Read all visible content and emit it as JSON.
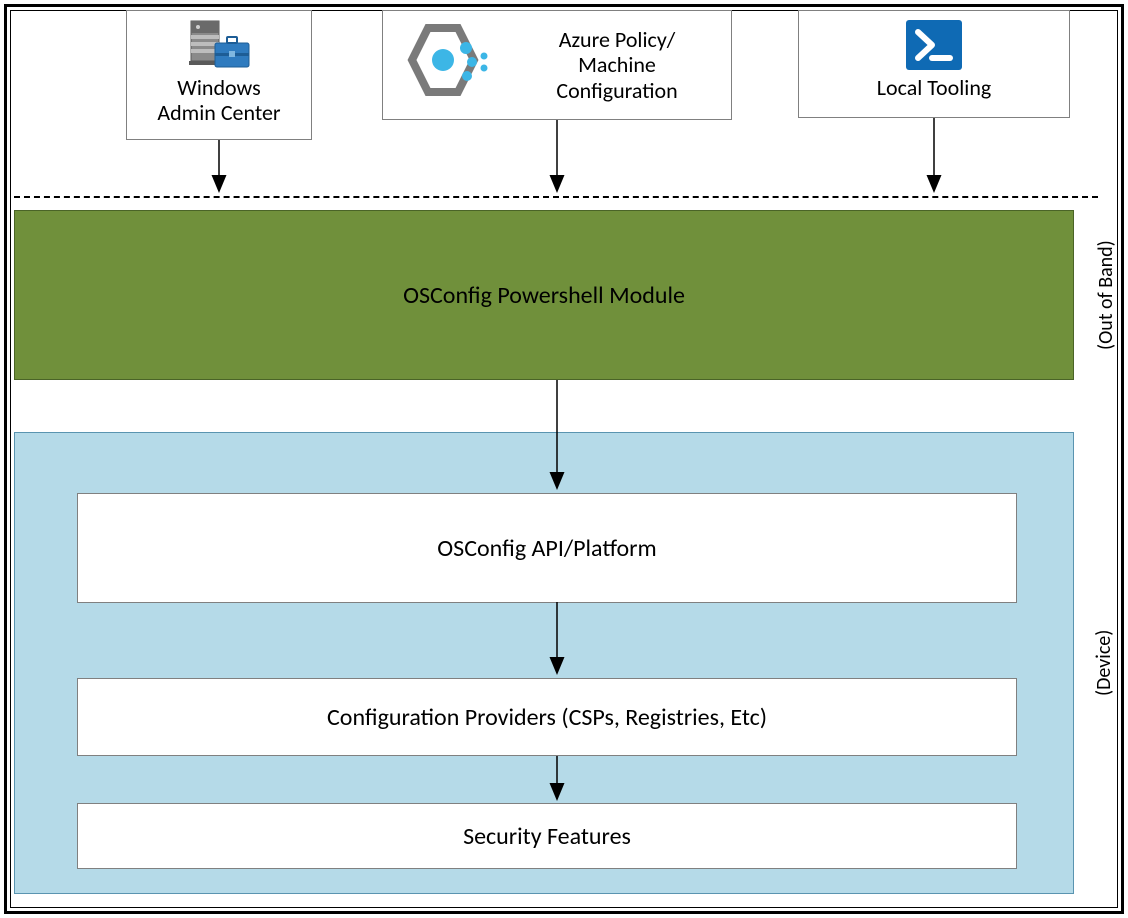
{
  "top_row": {
    "wac": {
      "label": "Windows\nAdmin Center",
      "icon": "server-briefcase-icon"
    },
    "azure_policy": {
      "label": "Azure Policy/\nMachine\nConfiguration",
      "icon": "azure-policy-icon"
    },
    "local_tooling": {
      "label": "Local Tooling",
      "icon": "powershell-icon"
    }
  },
  "layers": {
    "osconfig_module": "OSConfig Powershell Module",
    "api_platform": "OSConfig API/Platform",
    "config_providers": "Configuration Providers (CSPs, Registries, Etc)",
    "security_features": "Security Features"
  },
  "side_labels": {
    "out_of_band": "(Out of Band)",
    "device": "(Device)"
  },
  "colors": {
    "green_band_bg": "#70903b",
    "green_band_border": "#4a6427",
    "device_bg": "#b5dae8",
    "device_border": "#5a94b0",
    "powershell_blue": "#0f6ab4"
  }
}
